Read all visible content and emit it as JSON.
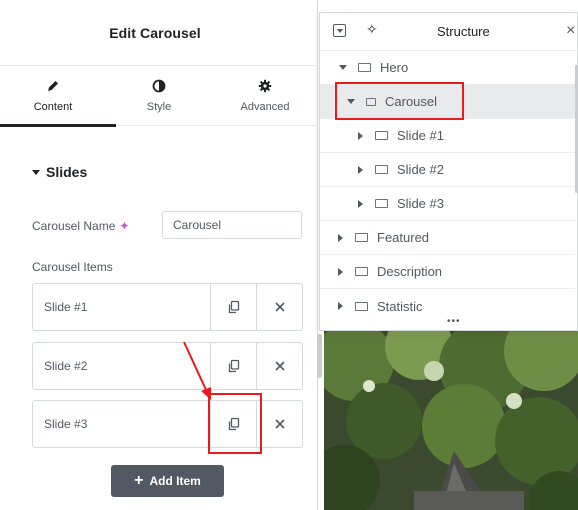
{
  "panel": {
    "title": "Edit Carousel",
    "tabs": [
      {
        "label": "Content",
        "icon": "pencil-icon",
        "active": true
      },
      {
        "label": "Style",
        "icon": "contrast-icon",
        "active": false
      },
      {
        "label": "Advanced",
        "icon": "gear-icon",
        "active": false
      }
    ],
    "section_title": "Slides",
    "carousel_name_label": "Carousel Name",
    "carousel_name_value": "Carousel",
    "items_label": "Carousel Items",
    "items": [
      {
        "label": "Slide #1"
      },
      {
        "label": "Slide #2"
      },
      {
        "label": "Slide #3"
      }
    ],
    "add_item_label": "Add Item"
  },
  "structure": {
    "title": "Structure",
    "rows": [
      {
        "label": "Hero",
        "expanded": true,
        "level": 0,
        "selected": false
      },
      {
        "label": "Carousel",
        "expanded": true,
        "level": 1,
        "selected": true
      },
      {
        "label": "Slide #1",
        "expanded": false,
        "level": 2,
        "selected": false
      },
      {
        "label": "Slide #2",
        "expanded": false,
        "level": 2,
        "selected": false
      },
      {
        "label": "Slide #3",
        "expanded": false,
        "level": 2,
        "selected": false
      },
      {
        "label": "Featured",
        "expanded": false,
        "level": 0,
        "selected": false
      },
      {
        "label": "Description",
        "expanded": false,
        "level": 0,
        "selected": false
      },
      {
        "label": "Statistic",
        "expanded": false,
        "level": 0,
        "selected": false
      }
    ]
  },
  "colors": {
    "annotation": "#e81c1c",
    "selected_row": "#e9eaec",
    "ai_sparkle": "#c84fd8",
    "button_bg": "#515962"
  }
}
